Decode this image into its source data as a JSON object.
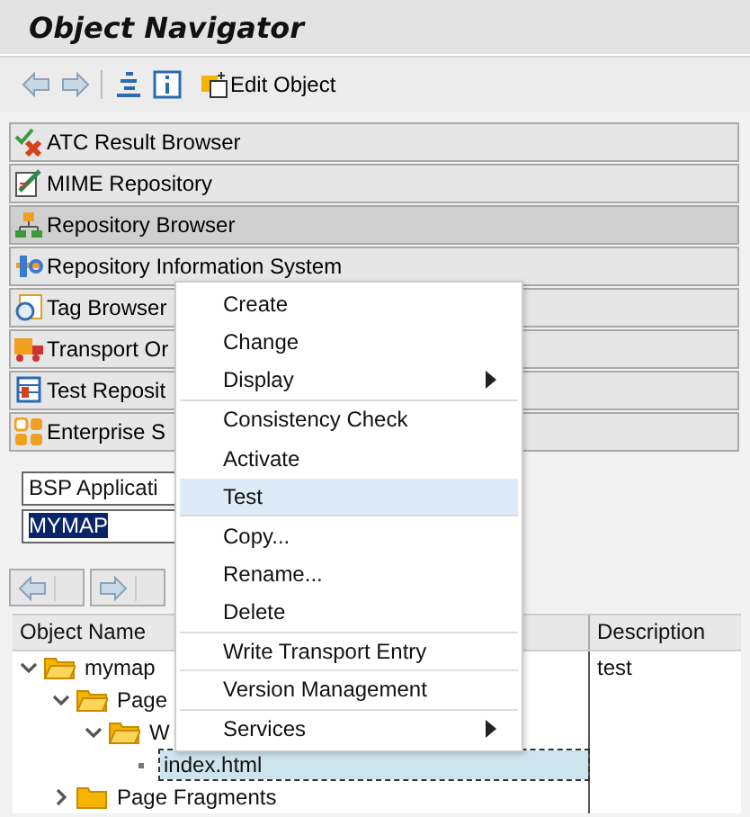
{
  "window": {
    "title": "Object Navigator"
  },
  "toolbar": {
    "edit_button": "Edit Object"
  },
  "browsers": [
    {
      "label": "ATC Result Browser",
      "selected": false
    },
    {
      "label": "MIME Repository",
      "selected": false
    },
    {
      "label": "Repository Browser",
      "selected": true
    },
    {
      "label": "Repository Information System",
      "selected": false
    },
    {
      "label": "Tag Browser",
      "selected": false
    },
    {
      "label": "Transport Or",
      "selected": false
    },
    {
      "label": "Test Reposit",
      "selected": false
    },
    {
      "label": "Enterprise S",
      "selected": false
    }
  ],
  "object_type": {
    "value": "BSP Applicati"
  },
  "object_name": {
    "value": "MYMAP",
    "selected": true
  },
  "table": {
    "columns": [
      "Object Name",
      "Description"
    ],
    "rows": [
      {
        "name": "mymap",
        "description": "test",
        "expanded": true,
        "selected": false,
        "children": [
          {
            "name": "Page",
            "expanded": true,
            "selected": false,
            "children": [
              {
                "name": "W",
                "expanded": true,
                "selected": false,
                "children": [
                  {
                    "name": "index.html",
                    "selected": true
                  }
                ]
              }
            ]
          },
          {
            "name": "Page Fragments",
            "expanded": false,
            "selected": false
          }
        ]
      }
    ]
  },
  "context_menu": [
    {
      "label": "Create",
      "kind": "item",
      "selected": false
    },
    {
      "label": "Change",
      "kind": "item",
      "selected": false
    },
    {
      "label": "Display",
      "kind": "submenu",
      "selected": false,
      "separator_after": true
    },
    {
      "label": "Consistency Check",
      "kind": "item",
      "selected": false
    },
    {
      "label": "Activate",
      "kind": "item",
      "selected": false
    },
    {
      "label": "Test",
      "kind": "item",
      "selected": true,
      "separator_after": true
    },
    {
      "label": "Copy...",
      "kind": "item",
      "selected": false
    },
    {
      "label": "Rename...",
      "kind": "item",
      "selected": false
    },
    {
      "label": "Delete",
      "kind": "item",
      "selected": false,
      "separator_after": true
    },
    {
      "label": "Write Transport Entry",
      "kind": "item",
      "selected": false,
      "separator_after": true
    },
    {
      "label": "Version Management",
      "kind": "item",
      "selected": false,
      "separator_after": true
    },
    {
      "label": "Services",
      "kind": "submenu",
      "selected": false
    }
  ]
}
